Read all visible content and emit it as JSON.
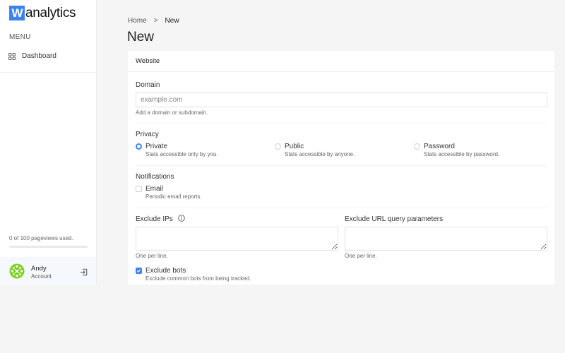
{
  "brand": {
    "logo_mark": "W",
    "logo_text": "analytics",
    "accent_color": "#3b82f6"
  },
  "sidebar": {
    "menu_label": "MENU",
    "items": [
      {
        "label": "Dashboard",
        "icon": "grid-icon"
      }
    ],
    "usage": {
      "text": "0 of 100 pageviews used.",
      "used": 0,
      "limit": 100
    },
    "account": {
      "name": "Andy",
      "subtitle": "Account",
      "logout_icon": "logout-icon"
    }
  },
  "breadcrumb": {
    "items": [
      "Home",
      "New"
    ],
    "separator": ">"
  },
  "page_title": "New",
  "form": {
    "section_title": "Website",
    "domain": {
      "label": "Domain",
      "placeholder": "example.com",
      "value": "",
      "help": "Add a domain or subdomain."
    },
    "privacy": {
      "label": "Privacy",
      "options": [
        {
          "title": "Private",
          "description": "Stats accessible only by you.",
          "selected": true
        },
        {
          "title": "Public",
          "description": "Stats accessible by anyone.",
          "selected": false
        },
        {
          "title": "Password",
          "description": "Stats accessible by password.",
          "selected": false
        }
      ]
    },
    "notifications": {
      "label": "Notifications",
      "email": {
        "title": "Email",
        "description": "Periodic email reports.",
        "checked": false
      }
    },
    "exclude_ips": {
      "label": "Exclude IPs",
      "value": "",
      "help": "One per line."
    },
    "exclude_params": {
      "label": "Exclude URL query parameters",
      "value": "",
      "help": "One per line."
    },
    "exclude_bots": {
      "title": "Exclude bots",
      "description": "Exclude common bots from being tracked.",
      "checked": true
    }
  }
}
